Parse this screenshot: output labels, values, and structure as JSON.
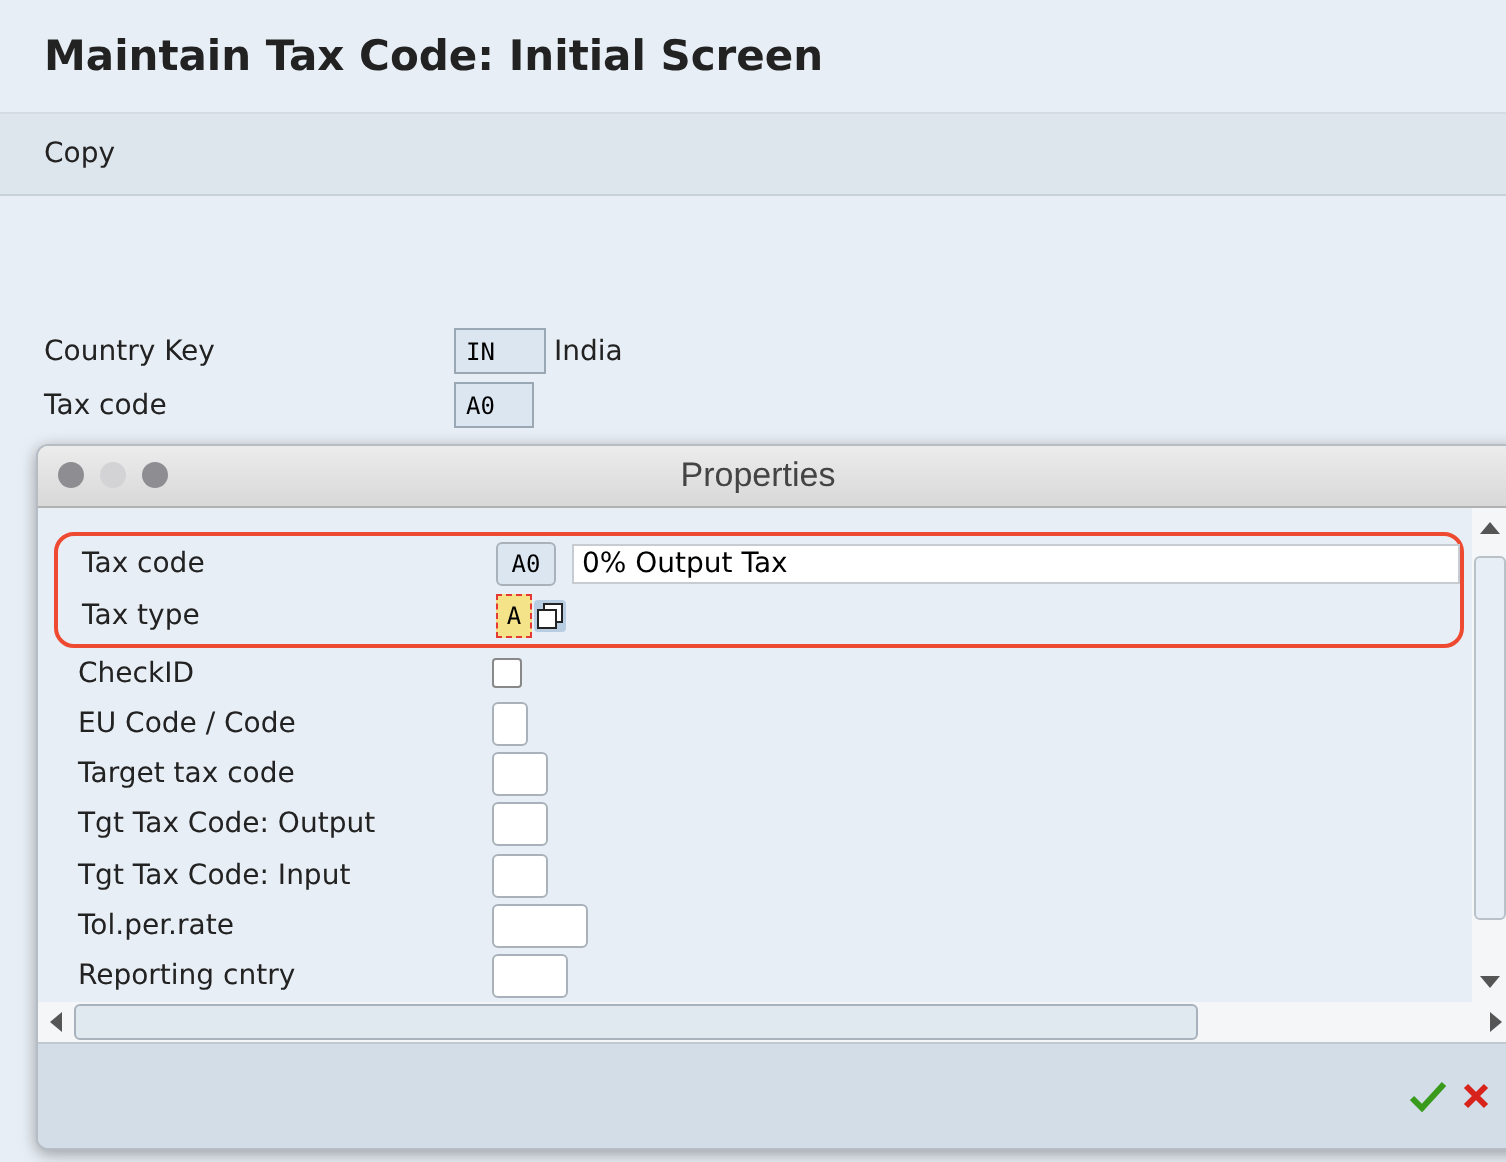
{
  "window": {
    "title": "Maintain Tax Code: Initial Screen"
  },
  "toolbar": [
    {
      "label": "Copy"
    }
  ],
  "header_fields": [
    {
      "label": "Country Key",
      "value": "IN",
      "description": "India"
    },
    {
      "label": "Tax code",
      "value": "A0"
    }
  ],
  "dialog": {
    "title": "Properties",
    "rows": [
      {
        "label": "Tax code",
        "kind": "field",
        "value": "A0",
        "description": "0% Output Tax",
        "highlighted": true,
        "focused": false
      },
      {
        "label": "Tax type",
        "kind": "field",
        "value": "A",
        "highlighted": true,
        "focused": true
      },
      {
        "label": "CheckID",
        "kind": "checkbox",
        "checked": false,
        "highlighted": false
      },
      {
        "label": "EU Code / Code",
        "kind": "field",
        "highlighted": false,
        "focused": false
      },
      {
        "label": "Target tax code",
        "kind": "field",
        "highlighted": false,
        "focused": false
      },
      {
        "label": "Tgt Tax Code: Output",
        "kind": "field",
        "highlighted": false,
        "focused": false
      },
      {
        "label": "Tgt Tax Code: Input",
        "kind": "field",
        "highlighted": false,
        "focused": false
      },
      {
        "label": "Tol.per.rate",
        "kind": "field",
        "highlighted": false,
        "focused": false
      },
      {
        "label": "Reporting cntry",
        "kind": "field",
        "highlighted": false,
        "focused": false
      }
    ]
  }
}
